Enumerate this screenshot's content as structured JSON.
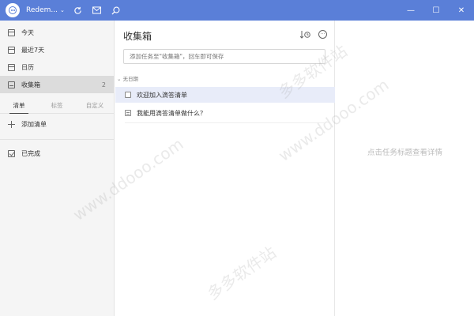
{
  "titlebar": {
    "username": "Redem...",
    "icons": [
      "sync-icon",
      "mail-icon",
      "search-icon"
    ],
    "window_controls": {
      "minimize": "—",
      "maximize": "☐",
      "close": "✕"
    }
  },
  "sidebar": {
    "smart_lists": [
      {
        "label": "今天",
        "icon": "calendar-icon",
        "count": ""
      },
      {
        "label": "最近7天",
        "icon": "calendar-icon",
        "count": ""
      },
      {
        "label": "日历",
        "icon": "calendar-icon",
        "count": ""
      },
      {
        "label": "收集箱",
        "icon": "inbox-icon",
        "count": "2",
        "active": true
      }
    ],
    "tabs": [
      {
        "label": "清单",
        "active": true
      },
      {
        "label": "标签",
        "active": false
      },
      {
        "label": "自定义",
        "active": false
      }
    ],
    "add_list": "添加清单",
    "completed": "已完成"
  },
  "main": {
    "title": "收集箱",
    "input_placeholder": "添加任务至\"收集箱\"，回车即可保存",
    "section_label": "无日期",
    "tasks": [
      {
        "title": "欢迎加入滴答清单",
        "selected": true
      },
      {
        "title": "我能用滴答清单做什么？",
        "selected": false
      }
    ]
  },
  "detail": {
    "hint": "点击任务标题查看详情"
  },
  "colors": {
    "accent": "#5a7fd8",
    "selected_row": "#e8ecf9",
    "sidebar_bg": "#f5f5f5"
  },
  "watermark": {
    "text_cn": "多多软件站",
    "text_en": "www.ddooo.com"
  }
}
